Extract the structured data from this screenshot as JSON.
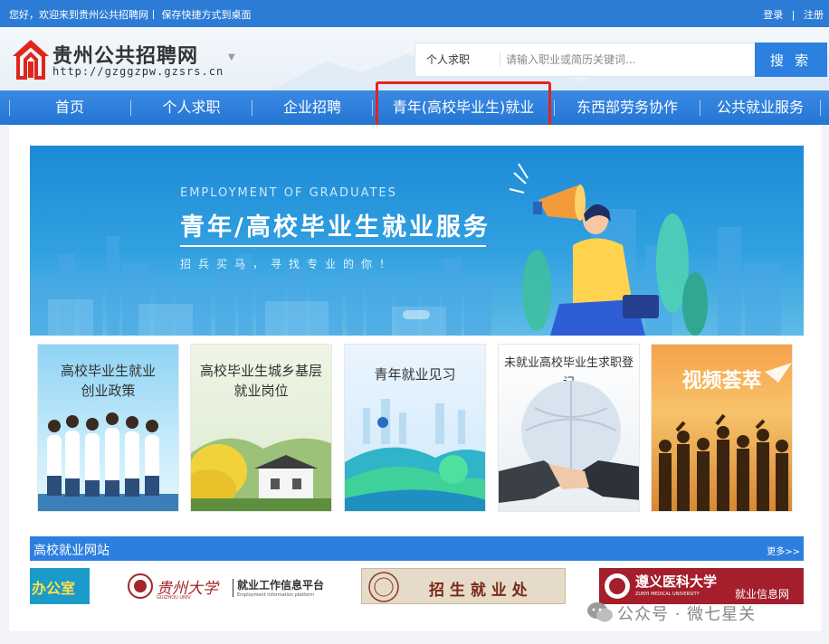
{
  "topbar": {
    "welcome": "您好，欢迎来到贵州公共招聘网丨 保存快捷方式到桌面",
    "login": "登录",
    "separator": "|",
    "register": "注册"
  },
  "header": {
    "site_name": "贵州公共招聘网",
    "site_url": "http://gzggzpw.gzsrs.cn",
    "search": {
      "category": "个人求职",
      "placeholder": "请输入职业或简历关键词...",
      "button": "搜 索"
    }
  },
  "nav": {
    "items": [
      {
        "label": "首页"
      },
      {
        "label": "个人求职"
      },
      {
        "label": "企业招聘"
      },
      {
        "label": "青年(高校毕业生)就业"
      },
      {
        "label": "东西部劳务协作"
      },
      {
        "label": "公共就业服务"
      }
    ],
    "highlighted_index": 3,
    "highlight_color": "#e5231e"
  },
  "banner": {
    "eyebrow": "EMPLOYMENT OF GRADUATES",
    "title": "青年/高校毕业生就业服务",
    "subtitle": "招兵买马，寻找专业的你！"
  },
  "cards": [
    {
      "label_line1": "高校毕业生就业",
      "label_line2": "创业政策"
    },
    {
      "label_line1": "高校毕业生城乡基层",
      "label_line2": "就业岗位"
    },
    {
      "label_line1": "青年就业见习",
      "label_line2": ""
    },
    {
      "label_line1": "未就业高校毕业生求职登记",
      "label_line2": ""
    },
    {
      "label_line1": "视频荟萃",
      "label_line2": ""
    }
  ],
  "section": {
    "title": "高校就业网站",
    "more": "更多>>"
  },
  "university_links": [
    {
      "text": "办公室"
    },
    {
      "text": "贵州大学",
      "sub": "就业工作信息平台",
      "sub2": "Employment information platform",
      "en": "GUIZHOU UNIV"
    },
    {
      "text": "招 生 就 业 处"
    },
    {
      "text": "遵义医科大学",
      "sub": "就业信息网",
      "en": "ZUNYI MEDICAL UNIVERSITY"
    }
  ],
  "watermark": "公众号 · 微七星关",
  "colors": {
    "primary": "#2c7cd5",
    "nav": "#2475d3",
    "search_button": "#2b80e0",
    "highlight": "#e5231e"
  }
}
